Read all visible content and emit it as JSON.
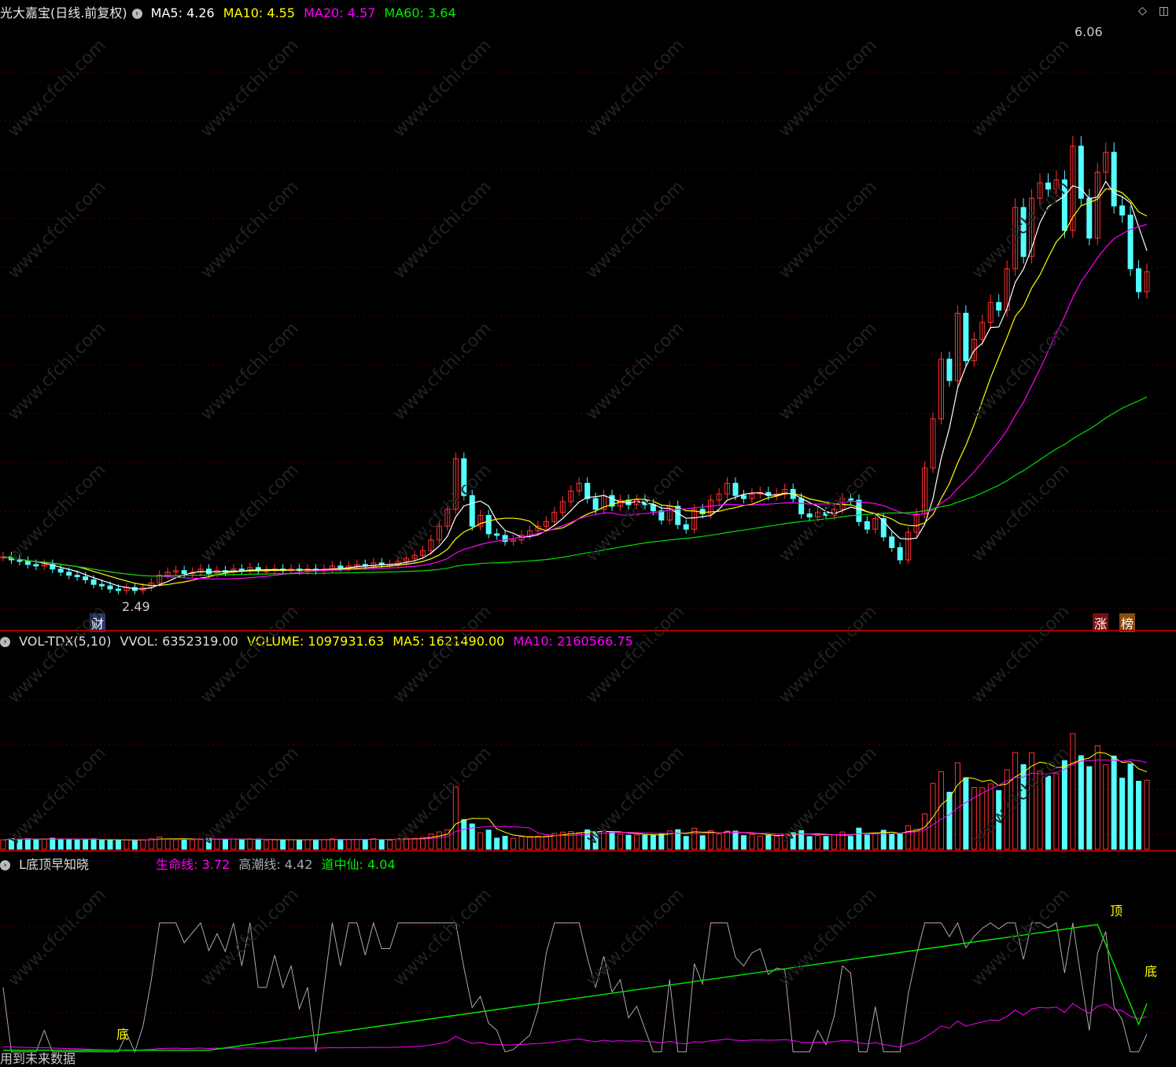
{
  "main": {
    "title": "光大嘉宝(日线.前复权)",
    "ma5": "MA5: 4.26",
    "ma10": "MA10: 4.55",
    "ma20": "MA20: 4.57",
    "ma60": "MA60: 3.64",
    "high_label": "6.06",
    "low_label": "2.49",
    "badge_cai": "财",
    "badge_zhang": "涨",
    "badge_bang": "榜",
    "colors": {
      "up": "#ff3232",
      "down": "#54ffff",
      "ma5": "#ffffff",
      "ma10": "#ffff00",
      "ma20": "#ff00ff",
      "ma60": "#00e000"
    }
  },
  "volume": {
    "title": "VOL-TDX(5,10)",
    "vvol": "VVOL: 6352319.00",
    "volume": "VOLUME: 1097931.63",
    "ma5": "MA5: 1621490.00",
    "ma10": "MA10: 2160566.75"
  },
  "indicator": {
    "title": "L底顶早知晓",
    "life": "生命线: 3.72",
    "tide": "高潮线: 4.42",
    "dao": "道中仙: 4.04",
    "top_label": "顶",
    "bottom_label": "底",
    "bottom_label2": "底",
    "footer": "用到未来数据"
  },
  "watermark": "www.cfchi.com",
  "chart_data": {
    "type": "candlestick",
    "price_range": [
      2.3,
      6.2
    ],
    "high": 6.06,
    "low": 2.49,
    "last_values": {
      "MA5": 4.26,
      "MA10": 4.55,
      "MA20": 4.57,
      "MA60": 3.64
    },
    "volume_last": {
      "VVOL": 6352319.0,
      "VOLUME": 1097931.63,
      "MA5": 1621490.0,
      "MA10": 2160566.75
    },
    "indicator_last": {
      "生命线": 3.72,
      "高潮线": 4.42,
      "道中仙": 4.04
    },
    "closes": [
      2.72,
      2.7,
      2.69,
      2.67,
      2.66,
      2.67,
      2.64,
      2.62,
      2.6,
      2.59,
      2.57,
      2.54,
      2.53,
      2.51,
      2.5,
      2.52,
      2.5,
      2.52,
      2.55,
      2.6,
      2.62,
      2.63,
      2.61,
      2.62,
      2.64,
      2.61,
      2.63,
      2.62,
      2.64,
      2.63,
      2.65,
      2.63,
      2.63,
      2.64,
      2.63,
      2.64,
      2.63,
      2.64,
      2.63,
      2.64,
      2.66,
      2.65,
      2.66,
      2.67,
      2.66,
      2.68,
      2.67,
      2.67,
      2.69,
      2.71,
      2.73,
      2.76,
      2.83,
      2.92,
      3.03,
      3.36,
      3.12,
      2.92,
      2.99,
      2.87,
      2.86,
      2.82,
      2.83,
      2.86,
      2.89,
      2.92,
      2.95,
      3.01,
      3.08,
      3.15,
      3.2,
      3.1,
      3.03,
      3.12,
      3.05,
      3.09,
      3.06,
      3.09,
      3.06,
      3.02,
      2.96,
      3.05,
      2.93,
      2.9,
      3.03,
      3.0,
      3.09,
      3.13,
      3.2,
      3.12,
      3.1,
      3.13,
      3.14,
      3.12,
      3.13,
      3.16,
      3.1,
      3.0,
      2.98,
      3.01,
      2.99,
      3.03,
      3.1,
      3.09,
      2.95,
      2.9,
      2.97,
      2.85,
      2.78,
      2.7,
      2.88,
      3.0,
      3.3,
      3.62,
      4.01,
      3.87,
      4.31,
      4.0,
      4.14,
      4.25,
      4.38,
      4.33,
      4.6,
      5.0,
      4.68,
      5.06,
      5.16,
      5.12,
      5.18,
      4.85,
      5.4,
      5.06,
      4.8,
      5.23,
      5.36,
      5.01,
      4.95,
      4.6,
      4.45,
      4.58
    ]
  }
}
